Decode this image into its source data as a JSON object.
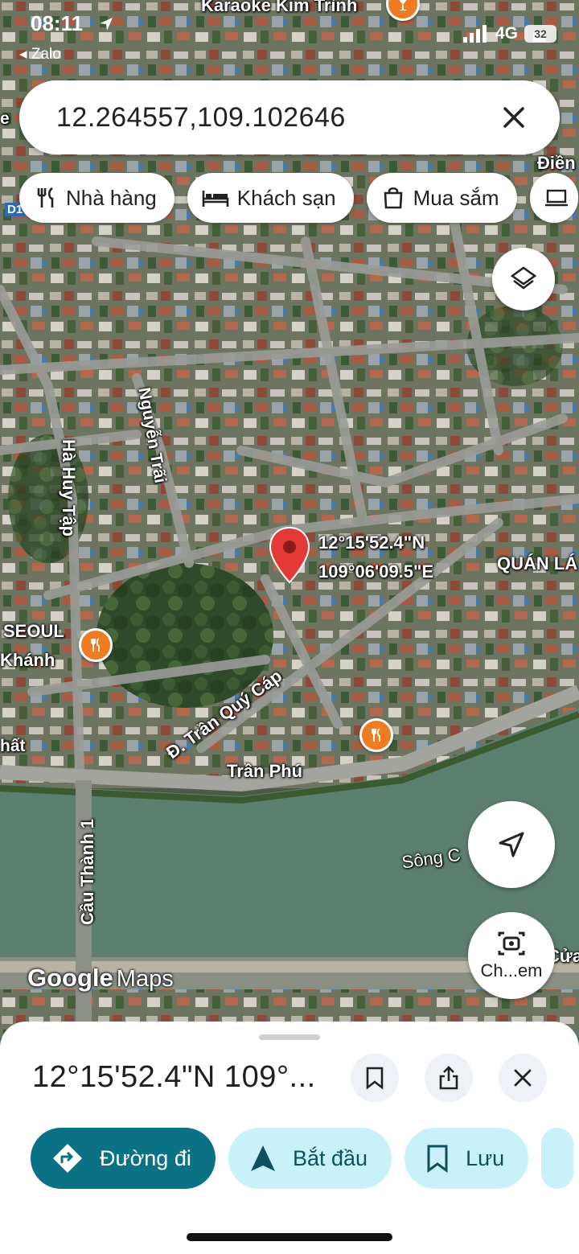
{
  "status_bar": {
    "time": "08:11",
    "back_app": "Zalo",
    "network": "4G",
    "battery": "32"
  },
  "search": {
    "value": "12.264557,109.102646"
  },
  "chips": [
    {
      "label": "Nhà hàng",
      "icon": "restaurant-icon"
    },
    {
      "label": "Khách sạn",
      "icon": "hotel-icon"
    },
    {
      "label": "Mua sắm",
      "icon": "shopping-bag-icon"
    }
  ],
  "map": {
    "top_place": "Karaoke Kim Trình",
    "pin_coords": {
      "lat": "12°15'52.4\"N",
      "lng": "109°06'09.5\"E"
    },
    "labels": {
      "ha_huy_tap": "Hà Huy Tập",
      "nguyen_trai": "Nguyễn Trãi",
      "tran_quy_cap": "Đ. Trần Quý Cáp",
      "tran_phu": "Trần Phú",
      "cau_thanh": "Cầu Thành 1",
      "seoul": "SEOUL",
      "khanh": "Khánh",
      "quan_la": "QUÁN LÁ",
      "song": "Sông C",
      "dien": "Điền",
      "cua": "Cửa",
      "nhat": "hất",
      "e_left": "e",
      "d1": "D1"
    },
    "logo_google": "Google",
    "logo_maps": "Maps",
    "lens_label": "Ch...em"
  },
  "sheet": {
    "title": "12°15'52.4\"N 109°...",
    "actions": [
      {
        "label": "Đường đi",
        "icon": "directions-icon"
      },
      {
        "label": "Bắt đầu",
        "icon": "navigation-arrow-icon"
      },
      {
        "label": "Lưu",
        "icon": "bookmark-icon"
      }
    ]
  },
  "colors": {
    "accent": "#0b7285",
    "pin": "#e53935",
    "poi": "#f07c22",
    "river": "#5d7f70"
  }
}
